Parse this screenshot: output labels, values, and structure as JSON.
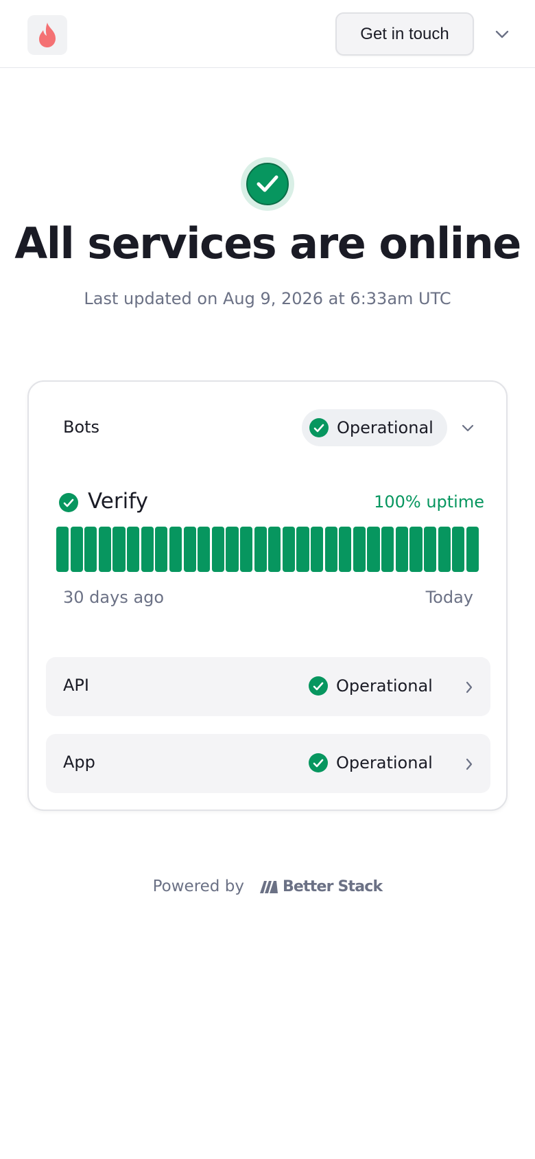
{
  "header": {
    "logo_icon": "flame-icon",
    "contact_label": "Get in touch",
    "menu_icon": "chevron-down-icon"
  },
  "hero": {
    "status_icon": "check-circle-icon",
    "title": "All services are online",
    "subtitle": "Last updated on Aug 9, 2026 at 6:33am UTC"
  },
  "status_group": {
    "name": "Bots",
    "status": "Operational",
    "service": {
      "name": "Verify",
      "uptime_label": "100% uptime",
      "days_shown": 30,
      "daily_status": "all operational",
      "range_start_label": "30 days ago",
      "range_end_label": "Today"
    }
  },
  "services": [
    {
      "name": "API",
      "status": "Operational"
    },
    {
      "name": "App",
      "status": "Operational"
    }
  ],
  "footer": {
    "powered_label": "Powered by",
    "brand_name": "Better Stack"
  },
  "colors": {
    "operational": "#07965f",
    "text": "#1a1b25",
    "muted": "#6b7185",
    "logo_flame": "#f47173"
  }
}
